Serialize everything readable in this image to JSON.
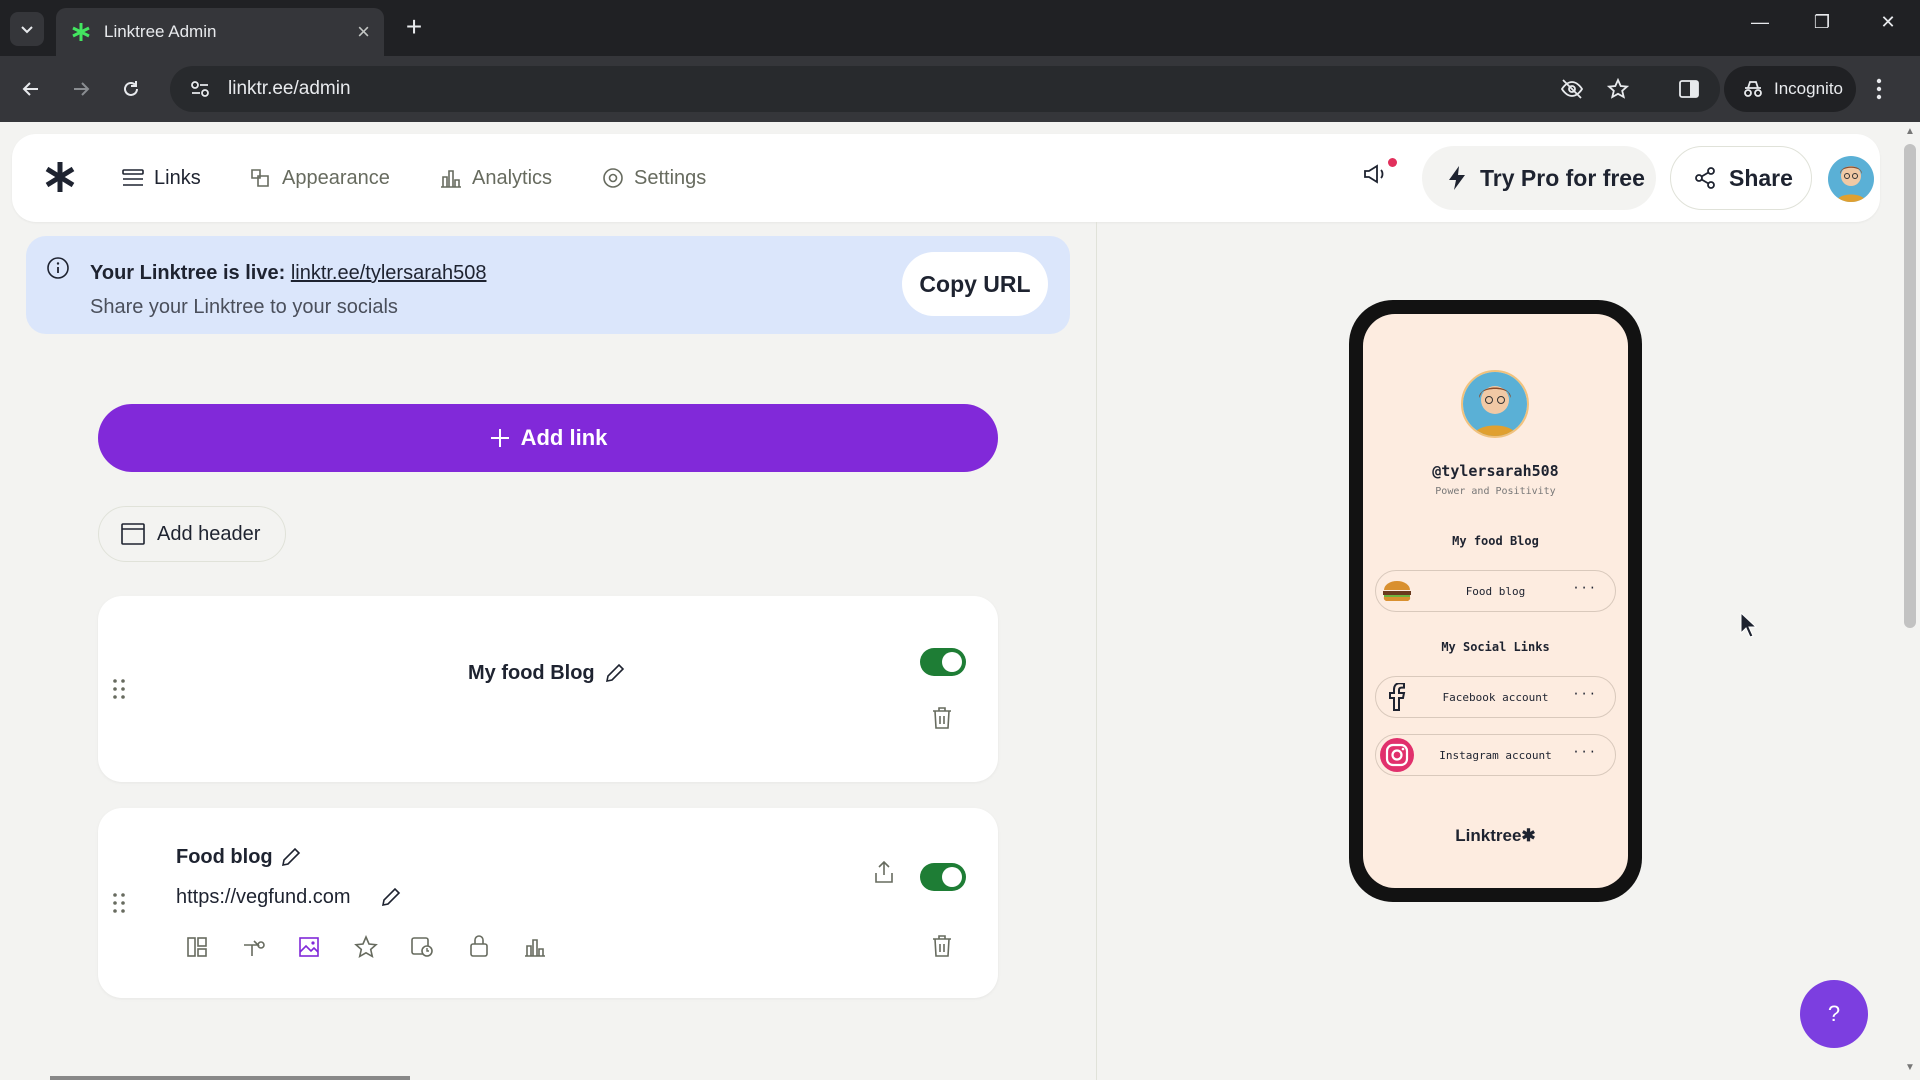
{
  "browser": {
    "tab_title": "Linktree Admin",
    "url": "linktr.ee/admin",
    "incognito_label": "Incognito"
  },
  "nav": {
    "links": "Links",
    "appearance": "Appearance",
    "analytics": "Analytics",
    "settings": "Settings",
    "try_pro": "Try Pro for free",
    "share": "Share"
  },
  "banner": {
    "live_label": "Your Linktree is live:",
    "live_url": "linktr.ee/tylersarah508",
    "subtext": "Share your Linktree to your socials",
    "copy_button": "Copy URL"
  },
  "actions": {
    "add_link": "Add link",
    "add_header": "Add header"
  },
  "cards": {
    "header_title": "My food Blog",
    "link_title": "Food blog",
    "link_url": "https://vegfund.com"
  },
  "preview": {
    "handle": "@tylersarah508",
    "bio": "Power and Positivity",
    "section1": "My food Blog",
    "btn1": "Food blog",
    "section2": "My Social Links",
    "btn2": "Facebook account",
    "btn3": "Instagram account",
    "more": "···",
    "footer": "Linktree✱"
  },
  "help_label": "?",
  "colors": {
    "accent_purple": "#8129d9",
    "toggle_green": "#1e7d35",
    "banner_blue": "#dbe6fb",
    "preview_bg": "#fdece0"
  }
}
